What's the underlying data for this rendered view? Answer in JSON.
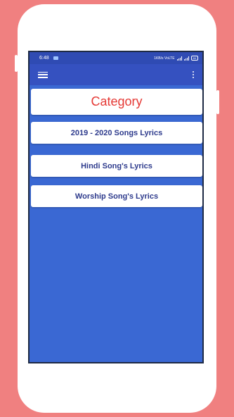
{
  "status_bar": {
    "time": "6:48",
    "indicators": "1KB/s VoLTE",
    "battery": "60"
  },
  "toolbar": {
    "menu_icon": "hamburger-menu-icon",
    "overflow_icon": "more-vert-icon"
  },
  "page": {
    "title": "Category"
  },
  "categories": [
    {
      "label": "2019 - 2020 Songs Lyrics"
    },
    {
      "label": "Hindi Song's Lyrics"
    },
    {
      "label": "Worship Song's Lyrics"
    }
  ],
  "colors": {
    "background": "#f08080",
    "app_bar": "#3551c0",
    "screen_bg": "#3a68d3",
    "title_text": "#e53935",
    "item_text": "#2d3a8c"
  }
}
